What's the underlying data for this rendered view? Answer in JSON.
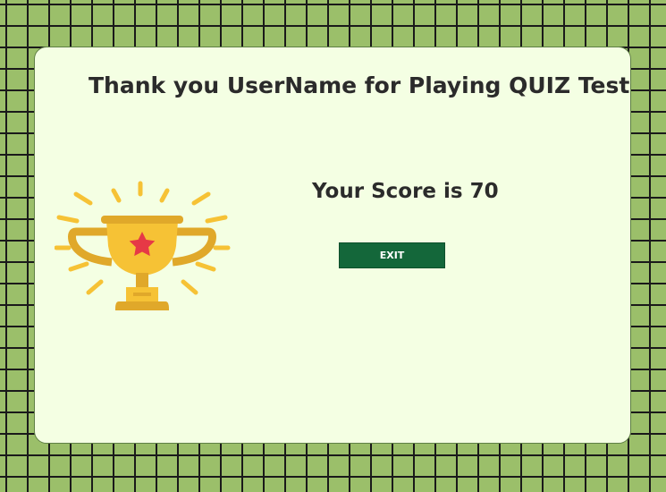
{
  "dialog": {
    "title": "Thank you UserName for Playing QUIZ Test",
    "score_text": "Your Score is 70",
    "exit_label": "EXIT",
    "trophy_icon": "trophy-icon"
  },
  "colors": {
    "background": "#9bbf6a",
    "card": "#f4ffe3",
    "button": "#14673a",
    "text": "#2b2b2b",
    "trophy_gold": "#f6c235",
    "trophy_dark_gold": "#e0a82a",
    "star": "#e63946"
  }
}
